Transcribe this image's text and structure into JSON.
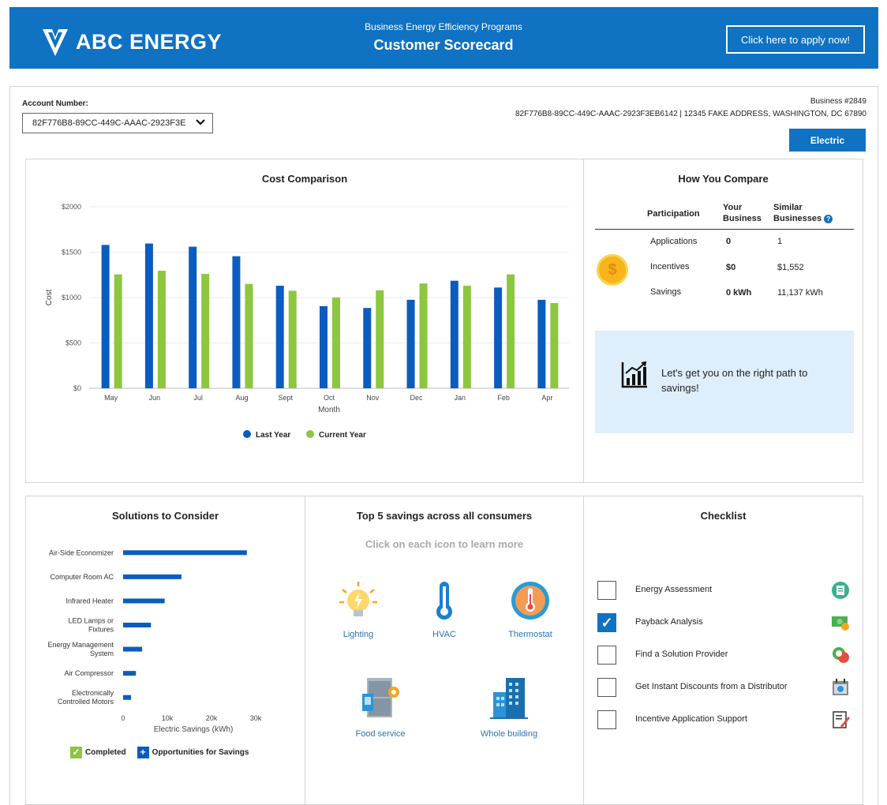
{
  "header": {
    "logo_text": "ABC ENERGY",
    "subtitle": "Business Energy Efficiency Programs",
    "title": "Customer Scorecard",
    "apply_label": "Click here to apply now!"
  },
  "account": {
    "label": "Account Number:",
    "selected": "82F776B8-89CC-449C-AAAC-2923F3E",
    "business": "Business #2849",
    "address": "82F776B8-89CC-449C-AAAC-2923F3EB6142 | 12345 FAKE ADDRESS, WASHINGTON, DC 67890",
    "fuel_button": "Electric"
  },
  "cost_comparison": {
    "title": "Cost Comparison",
    "chart_data": {
      "type": "bar",
      "title": "Cost Comparison",
      "xlabel": "Month",
      "ylabel": "Cost",
      "ylim": [
        0,
        2000
      ],
      "yticks": [
        "$2000",
        "$1500",
        "$1000",
        "$500",
        "$0"
      ],
      "categories": [
        "May",
        "Jun",
        "Jul",
        "Aug",
        "Sept",
        "Oct",
        "Nov",
        "Dec",
        "Jan",
        "Feb",
        "Apr"
      ],
      "series": [
        {
          "name": "Last Year",
          "color": "#0b5cc0",
          "values": [
            1580,
            1595,
            1560,
            1455,
            1130,
            905,
            885,
            975,
            1185,
            1110,
            975
          ]
        },
        {
          "name": "Current Year",
          "color": "#8dc63f",
          "values": [
            1255,
            1295,
            1260,
            1150,
            1075,
            1000,
            1080,
            1155,
            1130,
            1255,
            940
          ]
        }
      ],
      "grid": true,
      "legend": "bottom"
    }
  },
  "compare": {
    "title": "How You Compare",
    "col1": "Participation",
    "col2": "Your Business",
    "col3": "Similar Businesses",
    "rows": [
      {
        "label": "Applications",
        "yours": "0",
        "similar": "1"
      },
      {
        "label": "Incentives",
        "yours": "$0",
        "similar": "$1,552"
      },
      {
        "label": "Savings",
        "yours": "0 kWh",
        "similar": "11,137 kWh"
      }
    ],
    "coin_symbol": "$",
    "help_symbol": "?",
    "path_text": "Let's get you on the right path to savings!"
  },
  "solutions": {
    "title": "Solutions to Consider",
    "chart_data": {
      "type": "bar",
      "orientation": "horizontal",
      "xlabel": "Electric Savings (kWh)",
      "xlim": [
        0,
        30000
      ],
      "xticks": [
        "0",
        "10k",
        "20k",
        "30k"
      ],
      "categories": [
        "Air-Side Economizer",
        "Computer Room AC",
        "Infrared Heater",
        "LED Lamps or Fixtures",
        "Energy Management System",
        "Air Compressor",
        "Electronically Controlled Motors"
      ],
      "values": [
        28000,
        13200,
        9400,
        6300,
        4300,
        2900,
        1800
      ],
      "color": "#0b5cc0"
    },
    "legend_completed": "Completed",
    "legend_opportunities": "Opportunities for Savings",
    "check_symbol": "✓",
    "plus_symbol": "+"
  },
  "top5": {
    "title": "Top 5 savings across all consumers",
    "subtitle": "Click on each icon to learn more",
    "items": [
      {
        "label": "Lighting",
        "icon": "lightbulb-icon"
      },
      {
        "label": "HVAC",
        "icon": "thermometer-icon"
      },
      {
        "label": "Thermostat",
        "icon": "thermostat-icon"
      },
      {
        "label": "Food service",
        "icon": "refrigerator-icon"
      },
      {
        "label": "Whole building",
        "icon": "building-icon"
      }
    ]
  },
  "checklist": {
    "title": "Checklist",
    "check_symbol": "✓",
    "items": [
      {
        "label": "Energy Assessment",
        "checked": false,
        "icon": "assessment-icon"
      },
      {
        "label": "Payback Analysis",
        "checked": true,
        "icon": "money-icon"
      },
      {
        "label": "Find a Solution Provider",
        "checked": false,
        "icon": "chat-icon"
      },
      {
        "label": "Get Instant Discounts from a Distributor",
        "checked": false,
        "icon": "discount-icon"
      },
      {
        "label": "Incentive Application Support",
        "checked": false,
        "icon": "application-form-icon"
      }
    ]
  }
}
